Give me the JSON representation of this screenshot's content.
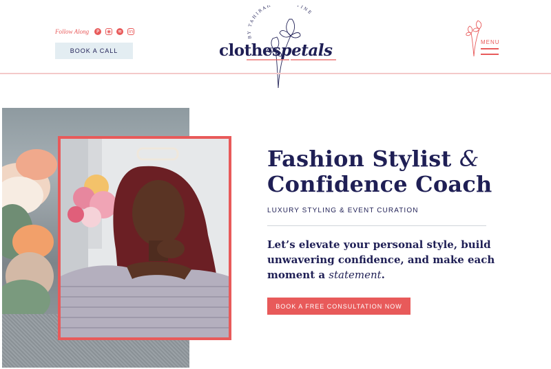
{
  "header": {
    "follow_label": "Follow Along",
    "social_icons": [
      "pinterest-icon",
      "instagram-icon",
      "spotify-icon",
      "linkedin-icon"
    ],
    "book_call_label": "BOOK A CALL",
    "menu_label": "MENU"
  },
  "logo": {
    "arc_text": "BY TAHIRAH CHRISTINE",
    "word_part1": "clothes",
    "word_part2": "petals"
  },
  "hero": {
    "title_line1": "Fashion Stylist",
    "title_amp": "&",
    "title_line2": "Confidence Coach",
    "subtitle": "LUXURY STYLING & EVENT CURATION",
    "lead_main": "Let’s elevate your personal style, build unwavering confidence, and make each moment a ",
    "lead_emphasis": "statement",
    "lead_end": ".",
    "cta_label": "BOOK A FREE CONSULTATION NOW"
  },
  "colors": {
    "navy": "#1f1f55",
    "coral": "#e85a5a",
    "pale_blue": "#e3edf2",
    "pink_rule": "#f4c9c9"
  }
}
